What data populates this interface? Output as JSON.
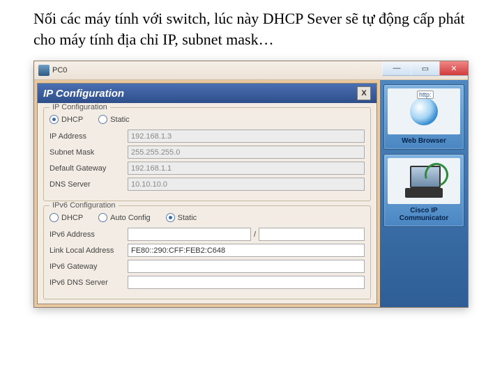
{
  "caption": "Nối các máy tính với switch, lúc này DHCP Sever sẽ tự động cấp phát cho máy tính địa chỉ IP, subnet mask…",
  "window": {
    "title": "PC0"
  },
  "dialog": {
    "title": "IP Configuration",
    "ipv4": {
      "heading": "IP Configuration",
      "radios": {
        "dhcp": "DHCP",
        "static": "Static",
        "selected": "dhcp"
      },
      "fields": {
        "ip_label": "IP Address",
        "ip_value": "192.168.1.3",
        "mask_label": "Subnet Mask",
        "mask_value": "255.255.255.0",
        "gw_label": "Default Gateway",
        "gw_value": "192.168.1.1",
        "dns_label": "DNS Server",
        "dns_value": "10.10.10.0"
      }
    },
    "ipv6": {
      "heading": "IPv6 Configuration",
      "radios": {
        "dhcp": "DHCP",
        "auto": "Auto Config",
        "static": "Static",
        "selected": "static"
      },
      "fields": {
        "addr_label": "IPv6 Address",
        "addr_value": "",
        "prefix_value": "",
        "ll_label": "Link Local Address",
        "ll_value": "FE80::290:CFF:FEB2:C648",
        "gw_label": "IPv6 Gateway",
        "gw_value": "",
        "dns_label": "IPv6 DNS Server",
        "dns_value": ""
      }
    }
  },
  "apps": [
    {
      "label": "Web Browser",
      "icon": "globe-icon"
    },
    {
      "label": "Cisco IP Communicator",
      "icon": "ip-phone-icon"
    }
  ]
}
